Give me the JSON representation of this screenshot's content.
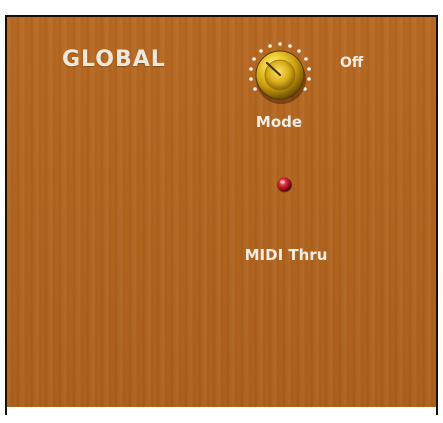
{
  "panel": {
    "title": "GLOBAL",
    "background_color": "#b3661f",
    "text_color": "#f4ece2"
  },
  "mode_knob": {
    "label": "Mode",
    "value": "Off",
    "icon": "gold-rotary-knob"
  },
  "midi_thru": {
    "label": "MIDI Thru",
    "icon": "red-led-button",
    "color": "#c8202e"
  }
}
